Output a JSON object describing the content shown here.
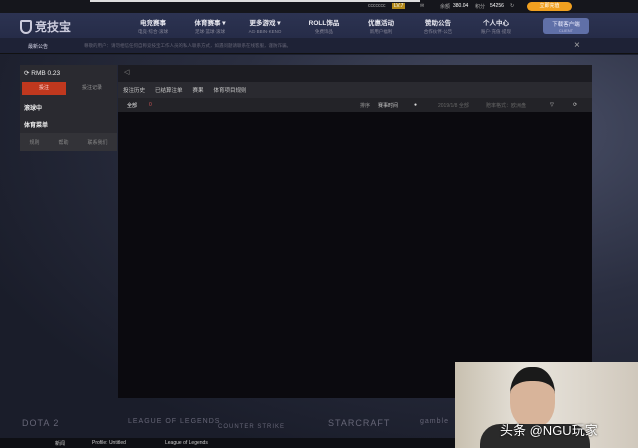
{
  "topbar": {
    "username": "ccccccc",
    "level": "LV.7",
    "balance_label": "余额",
    "balance": "380.04",
    "points_label": "积分",
    "points": "54256",
    "deposit_label": "立即充值"
  },
  "nav": {
    "logo": "竞技宝",
    "items": [
      {
        "title": "电竞赛事",
        "sub": "电竞·综合·滚球"
      },
      {
        "title": "体育赛事 ▾",
        "sub": "足球·篮球·滚球"
      },
      {
        "title": "更多游戏 ▾",
        "sub": "AG·BBIN·KENO"
      },
      {
        "title": "ROLL饰品",
        "sub": "免费饰品"
      },
      {
        "title": "优惠活动",
        "sub": "新用户福利"
      },
      {
        "title": "赞助公告",
        "sub": "合作伙伴·公告"
      },
      {
        "title": "个人中心",
        "sub": "账户·充值·提现"
      }
    ],
    "client_button": "下载客户端",
    "client_sub": "CLIENT"
  },
  "notice": {
    "label": "最新公告",
    "text": "尊敬的用户：请勿相信任何自称竞技宝工作人员的私人联系方式，如遇问题请联系在线客服，谨防诈骗。"
  },
  "left": {
    "balance": "RMB 0.23",
    "bet_tab": "投注",
    "history_tab": "投注记录",
    "in_play": "滚球中",
    "sports_slip": "体育菜单",
    "footer": [
      "规则",
      "帮助",
      "联系我们"
    ]
  },
  "main": {
    "tabs": [
      "投注历史",
      "已结算注单",
      "赛果",
      "体育项目规则"
    ],
    "filter_all": "全部",
    "filter_count": "0",
    "sort_label": "排序",
    "sort_value": "赛事时间",
    "date_label": "2019/1/8 全部",
    "odds_label": "赔率格式：欧洲盘"
  },
  "footer_logos": [
    "DOTA 2",
    "LEAGUE OF LEGENDS",
    "COUNTER STRIKE",
    "STARCRAFT",
    "gamble"
  ],
  "taskbar": [
    "新闻",
    "Profile: Untitled",
    "League of Legends"
  ],
  "watermark": "头条 @NGU玩家"
}
